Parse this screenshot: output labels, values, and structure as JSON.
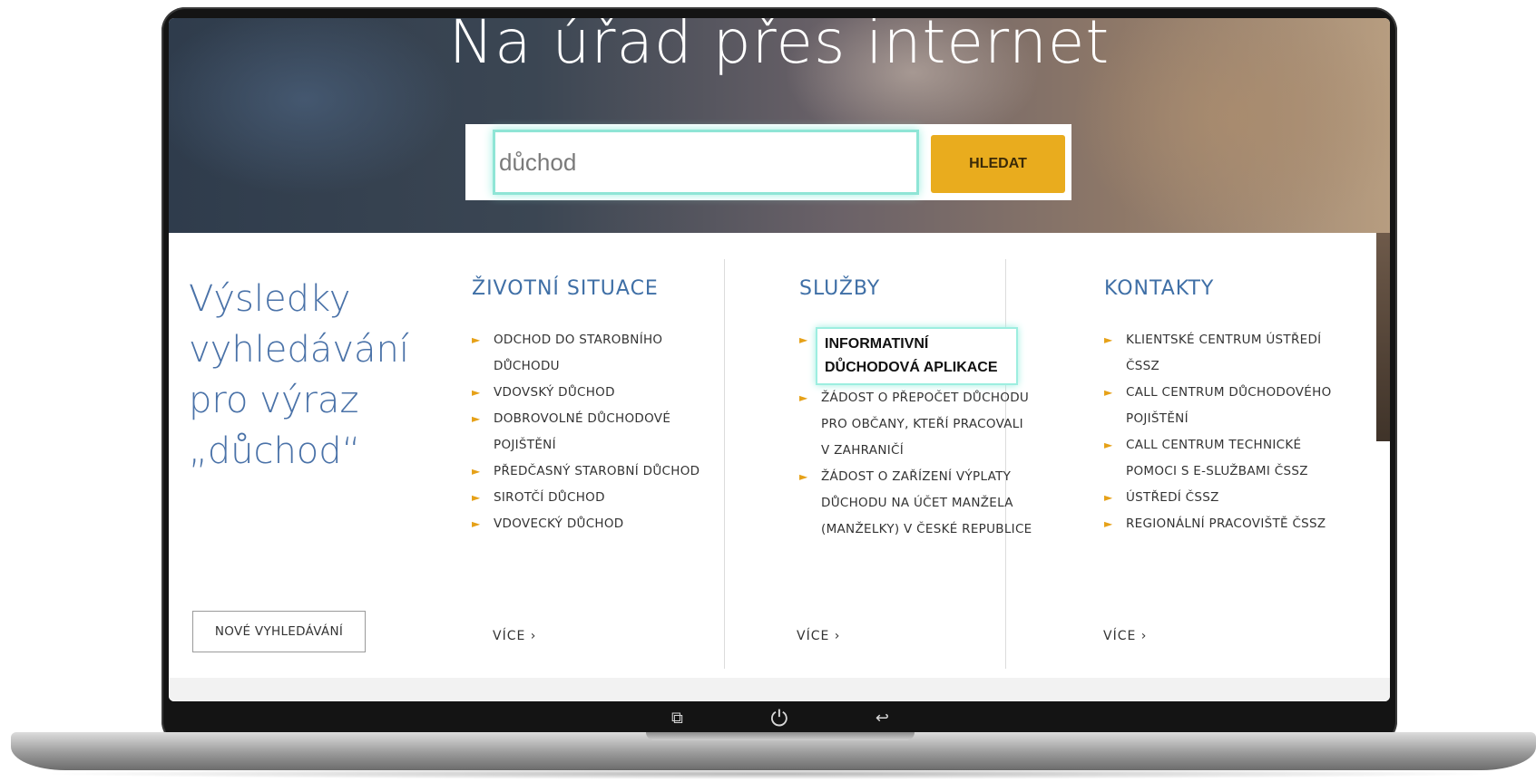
{
  "hero": {
    "title": "Na úřad přes internet",
    "search_value": "důchod",
    "search_button": "HLEDAT"
  },
  "results": {
    "title_lines": [
      "Výsledky",
      "vyhledávání",
      "pro výraz",
      "„důchod“"
    ],
    "new_search_button": "NOVÉ VYHLEDÁVÁNÍ"
  },
  "columns": [
    {
      "heading": "ŽIVOTNÍ SITUACE",
      "items": [
        [
          "ODCHOD DO STAROBNÍHO",
          "DŮCHODU"
        ],
        [
          "VDOVSKÝ DŮCHOD"
        ],
        [
          "DOBROVOLNÉ DŮCHODOVÉ",
          "POJIŠTĚNÍ"
        ],
        [
          "PŘEDČASNÝ STAROBNÍ DŮCHOD"
        ],
        [
          "SIROTČÍ DŮCHOD"
        ],
        [
          "VDOVECKÝ DŮCHOD"
        ]
      ],
      "more": "VÍCE ›"
    },
    {
      "heading": "SLUŽBY",
      "items": [
        [
          "INFORMATIVNÍ",
          "DŮCHODOVÁ APLIKACE"
        ],
        [
          "ŽÁDOST O PŘEPOČET DŮCHODU",
          "PRO OBČANY, KTEŘÍ PRACOVALI",
          "V ZAHRANIČÍ"
        ],
        [
          "ŽÁDOST O ZAŘÍZENÍ VÝPLATY",
          "DŮCHODU NA ÚČET MANŽELA",
          "(MANŽELKY) V ČESKÉ REPUBLICE"
        ]
      ],
      "more": "VÍCE ›"
    },
    {
      "heading": "KONTAKTY",
      "items": [
        [
          "KLIENTSKÉ CENTRUM ÚSTŘEDÍ",
          "ČSSZ"
        ],
        [
          "CALL CENTRUM DŮCHODOVÉHO",
          "POJIŠTĚNÍ"
        ],
        [
          "CALL CENTRUM TECHNICKÉ",
          "POMOCI S E-SLUŽBAMI ČSSZ"
        ],
        [
          "ÚSTŘEDÍ ČSSZ"
        ],
        [
          "REGIONÁLNÍ PRACOVIŠTĚ ČSSZ"
        ]
      ],
      "more": "VÍCE ›"
    }
  ],
  "device_nav": {
    "recent_icon": "recent-apps-icon",
    "power_icon": "power-icon",
    "back_icon": "back-icon"
  },
  "colors": {
    "accent": "#e9ac1e",
    "link_blue": "#3f6fa6",
    "highlight": "#9deee0"
  }
}
